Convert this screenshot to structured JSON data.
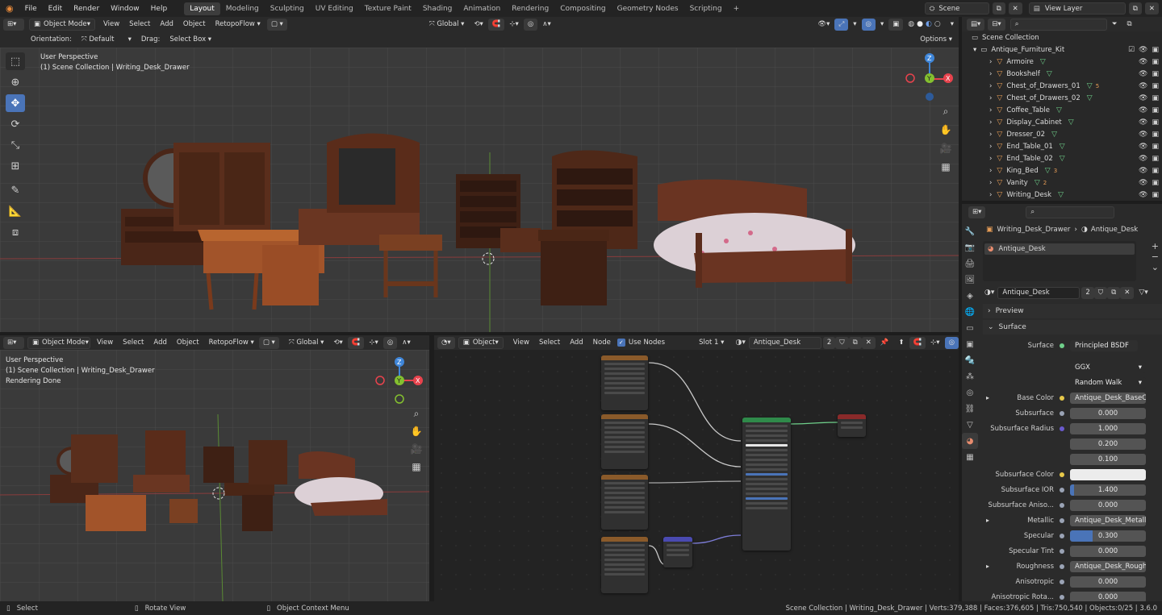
{
  "menus": [
    "File",
    "Edit",
    "Render",
    "Window",
    "Help"
  ],
  "workspaces": [
    {
      "label": "Layout",
      "active": true
    },
    {
      "label": "Modeling",
      "active": false
    },
    {
      "label": "Sculpting",
      "active": false
    },
    {
      "label": "UV Editing",
      "active": false
    },
    {
      "label": "Texture Paint",
      "active": false
    },
    {
      "label": "Shading",
      "active": false
    },
    {
      "label": "Animation",
      "active": false
    },
    {
      "label": "Rendering",
      "active": false
    },
    {
      "label": "Compositing",
      "active": false
    },
    {
      "label": "Geometry Nodes",
      "active": false
    },
    {
      "label": "Scripting",
      "active": false
    }
  ],
  "add_workspace_label": "+",
  "scene_name": "Scene",
  "view_layer_name": "View Layer",
  "top_viewport": {
    "mode": "Object Mode",
    "menus": [
      "View",
      "Select",
      "Add",
      "Object"
    ],
    "retopoflow": "RetopoFlow",
    "transform_orientation": "Global",
    "orientation_label": "Orientation:",
    "orientation_value": "Default",
    "drag_label": "Drag:",
    "drag_value": "Select Box",
    "options_label": "Options",
    "overlay_line1": "User Perspective",
    "overlay_line2": "(1) Scene Collection | Writing_Desk_Drawer"
  },
  "bottom_viewport": {
    "mode": "Object Mode",
    "menus": [
      "View",
      "Select",
      "Add",
      "Object"
    ],
    "retopoflow": "RetopoFlow",
    "transform_orientation": "Global",
    "overlay_line1": "User Perspective",
    "overlay_line2": "(1) Scene Collection | Writing_Desk_Drawer",
    "overlay_line3": "Rendering Done"
  },
  "node_editor": {
    "type": "Object",
    "menus": [
      "View",
      "Select",
      "Add",
      "Node"
    ],
    "use_nodes_label": "Use Nodes",
    "slot": "Slot 1",
    "material": "Antique_Desk",
    "user_count": "2"
  },
  "outliner": {
    "search_placeholder": "",
    "root": "Scene Collection",
    "collection": "Antique_Furniture_Kit",
    "items": [
      {
        "name": "Armoire",
        "sub": ""
      },
      {
        "name": "Bookshelf",
        "sub": ""
      },
      {
        "name": "Chest_of_Drawers_01",
        "sub": "5"
      },
      {
        "name": "Chest_of_Drawers_02",
        "sub": ""
      },
      {
        "name": "Coffee_Table",
        "sub": ""
      },
      {
        "name": "Display_Cabinet",
        "sub": ""
      },
      {
        "name": "Dresser_02",
        "sub": ""
      },
      {
        "name": "End_Table_01",
        "sub": ""
      },
      {
        "name": "End_Table_02",
        "sub": ""
      },
      {
        "name": "King_Bed",
        "sub": "3"
      },
      {
        "name": "Vanity",
        "sub": "2"
      },
      {
        "name": "Writing_Desk",
        "sub": ""
      }
    ]
  },
  "properties": {
    "breadcrumb_object": "Writing_Desk_Drawer",
    "breadcrumb_material": "Antique_Desk",
    "slot_item": "Antique_Desk",
    "material_name": "Antique_Desk",
    "material_users": "2",
    "preview_label": "Preview",
    "surface_panel_label": "Surface",
    "surface_label": "Surface",
    "surface_value": "Principled BSDF",
    "distribution": "GGX",
    "subsurface_method": "Random Walk",
    "rows": [
      {
        "label": "Base Color",
        "value": "Antique_Desk_BaseCol...",
        "kind": "link",
        "dot": "#e6c84a",
        "expand": true
      },
      {
        "label": "Subsurface",
        "value": "0.000",
        "kind": "num",
        "dot": "#9aa3b5",
        "expand": false
      },
      {
        "label": "Subsurface Radius",
        "value": "1.000",
        "kind": "num",
        "dot": "#6a5acd",
        "expand": false
      },
      {
        "label": "",
        "value": "0.200",
        "kind": "num",
        "dot": "",
        "expand": false
      },
      {
        "label": "",
        "value": "0.100",
        "kind": "num",
        "dot": "",
        "expand": false
      },
      {
        "label": "Subsurface Color",
        "value": "",
        "kind": "color",
        "dot": "#e6c84a",
        "expand": false
      },
      {
        "label": "Subsurface IOR",
        "value": "1.400",
        "kind": "bar",
        "fill": 0.05,
        "dot": "#9aa3b5",
        "expand": false
      },
      {
        "label": "Subsurface Aniso...",
        "value": "0.000",
        "kind": "num",
        "dot": "#9aa3b5",
        "expand": false
      },
      {
        "label": "Metallic",
        "value": "Antique_Desk_Metallic...",
        "kind": "link",
        "dot": "#9aa3b5",
        "expand": true
      },
      {
        "label": "Specular",
        "value": "0.300",
        "kind": "bar",
        "fill": 0.3,
        "dot": "#9aa3b5",
        "expand": false
      },
      {
        "label": "Specular Tint",
        "value": "0.000",
        "kind": "num",
        "dot": "#9aa3b5",
        "expand": false
      },
      {
        "label": "Roughness",
        "value": "Antique_Desk_Roughn...",
        "kind": "link",
        "dot": "#9aa3b5",
        "expand": true
      },
      {
        "label": "Anisotropic",
        "value": "0.000",
        "kind": "num",
        "dot": "#9aa3b5",
        "expand": false
      },
      {
        "label": "Anisotropic Rota...",
        "value": "0.000",
        "kind": "num",
        "dot": "#9aa3b5",
        "expand": false
      }
    ]
  },
  "statusbar": {
    "select": "Select",
    "rotate": "Rotate View",
    "context": "Object Context Menu",
    "stats": "Scene Collection | Writing_Desk_Drawer | Verts:379,388 | Faces:376,605 | Tris:750,540 | Objects:0/25 | 3.6.0"
  },
  "colors": {
    "accent": "#4a74b8",
    "selection": "#334d73",
    "object_orange": "#e89e57",
    "mesh_green": "#6fcf8a",
    "axis_x": "#e8434d",
    "axis_y": "#84c02f",
    "axis_z": "#3f86d9"
  }
}
